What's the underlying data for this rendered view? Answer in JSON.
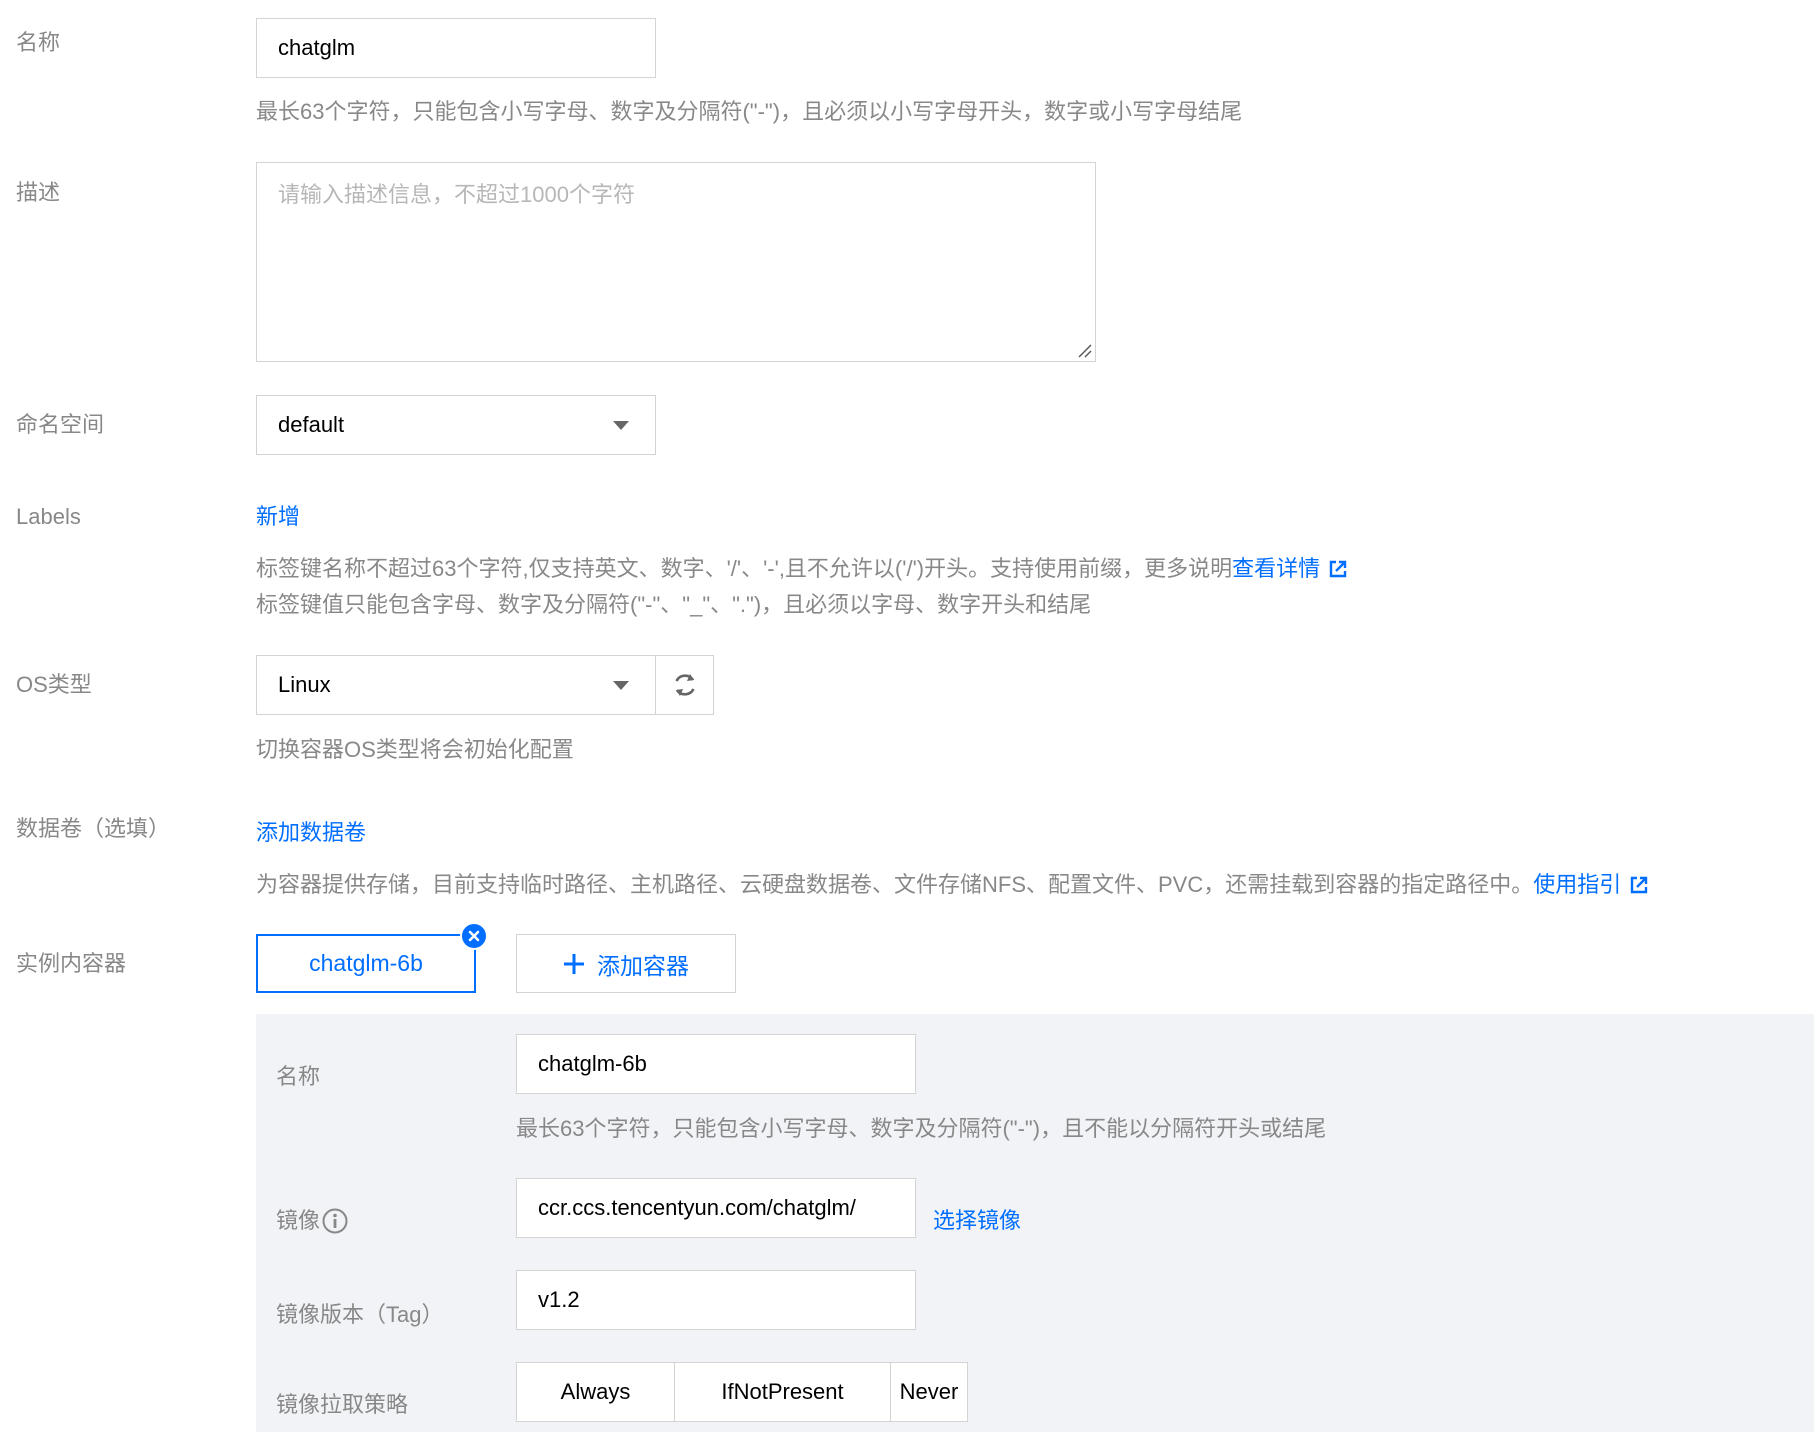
{
  "form": {
    "name": {
      "label": "名称",
      "value": "chatglm",
      "hint": "最长63个字符，只能包含小写字母、数字及分隔符(\"-\")，且必须以小写字母开头，数字或小写字母结尾"
    },
    "description": {
      "label": "描述",
      "placeholder": "请输入描述信息，不超过1000个字符"
    },
    "namespace": {
      "label": "命名空间",
      "value": "default"
    },
    "labels": {
      "label": "Labels",
      "add_link": "新增",
      "hint_line1": "标签键名称不超过63个字符,仅支持英文、数字、'/'、'-',且不允许以('/')开头。支持使用前缀，更多说明",
      "details_link": "查看详情",
      "hint_line2": "标签键值只能包含字母、数字及分隔符(\"-\"、\"_\"、\".\")，且必须以字母、数字开头和结尾"
    },
    "os_type": {
      "label": "OS类型",
      "value": "Linux",
      "hint": "切换容器OS类型将会初始化配置"
    },
    "volumes": {
      "label": "数据卷（选填）",
      "add_link": "添加数据卷",
      "hint": "为容器提供存储，目前支持临时路径、主机路径、云硬盘数据卷、文件存储NFS、配置文件、PVC，还需挂载到容器的指定路径中。",
      "guide_link": "使用指引"
    },
    "containers": {
      "label": "实例内容器",
      "tabs": [
        "chatglm-6b"
      ],
      "add_button": "添加容器",
      "container": {
        "name_label": "名称",
        "name_value": "chatglm-6b",
        "name_hint": "最长63个字符，只能包含小写字母、数字及分隔符(\"-\")，且不能以分隔符开头或结尾",
        "image_label": "镜像",
        "image_value": "ccr.ccs.tencentyun.com/chatglm/",
        "select_image_link": "选择镜像",
        "tag_label": "镜像版本（Tag）",
        "tag_value": "v1.2",
        "pull_policy_label": "镜像拉取策略",
        "pull_policy_options": [
          "Always",
          "IfNotPresent",
          "Never"
        ]
      }
    }
  },
  "colors": {
    "link": "#006eff",
    "label": "#888888",
    "border": "#d3d3d3",
    "panel_bg": "#f2f3f7"
  }
}
